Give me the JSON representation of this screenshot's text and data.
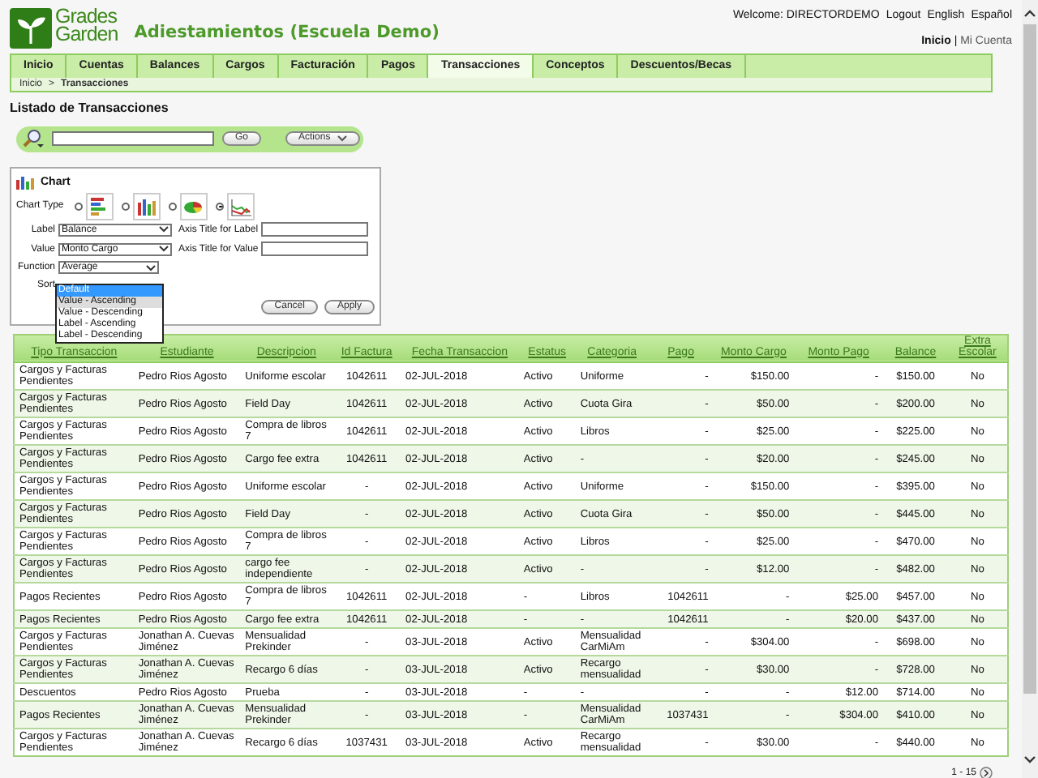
{
  "header": {
    "logo_line_1": "Grades",
    "logo_line_2": "Garden",
    "app_title": "Adiestamientos (Escuela Demo)",
    "user_links": [
      "Welcome: DIRECTORDEMO",
      "Logout",
      "English",
      "Español"
    ],
    "account_links": [
      {
        "label": "Inicio",
        "selected": true
      },
      {
        "label": "Mi Cuenta",
        "selected": false
      }
    ],
    "account_separator": "|"
  },
  "tabs": [
    {
      "label": "Inicio",
      "selected": false
    },
    {
      "label": "Cuentas",
      "selected": false
    },
    {
      "label": "Balances",
      "selected": false
    },
    {
      "label": "Cargos",
      "selected": false
    },
    {
      "label": "Facturación",
      "selected": false
    },
    {
      "label": "Pagos",
      "selected": false
    },
    {
      "label": "Transacciones",
      "selected": true
    },
    {
      "label": "Conceptos",
      "selected": false
    },
    {
      "label": "Descuentos/Becas",
      "selected": false
    }
  ],
  "breadcrumb": {
    "items": [
      "Inicio",
      "Transacciones"
    ],
    "separator": ">"
  },
  "page_title": "Listado de Transacciones",
  "search": {
    "go_button": "Go",
    "actions_button": "Actions"
  },
  "chart_panel": {
    "title": "Chart",
    "chart_type_label": "Chart Type",
    "chart_types": [
      {
        "kind": "bar",
        "selected": false
      },
      {
        "kind": "column",
        "selected": false
      },
      {
        "kind": "pie",
        "selected": false
      },
      {
        "kind": "line",
        "selected": true
      }
    ],
    "fields": [
      {
        "label": "Label",
        "value": "Balance",
        "axis_label": "Axis Title for Label"
      },
      {
        "label": "Value",
        "value": "Monto Cargo",
        "axis_label": "Axis Title for Value"
      }
    ],
    "function": {
      "label": "Function",
      "value": "Average"
    },
    "sort": {
      "label": "Sort",
      "options": [
        {
          "label": "Default",
          "selected": true,
          "hovered": false
        },
        {
          "label": "Value - Ascending",
          "selected": false,
          "hovered": true
        },
        {
          "label": "Value - Descending",
          "selected": false,
          "hovered": false
        },
        {
          "label": "Label - Ascending",
          "selected": false,
          "hovered": false
        },
        {
          "label": "Label - Descending",
          "selected": false,
          "hovered": false
        }
      ]
    },
    "buttons": [
      "Cancel",
      "Apply"
    ]
  },
  "table": {
    "columns": [
      "Tipo Transaccion",
      "Estudiante",
      "Descripcion",
      "Id Factura",
      "Fecha Transaccion",
      "Estatus",
      "Categoria",
      "Pago",
      "Monto Cargo",
      "Monto Pago",
      "Balance",
      "Extra Escolar"
    ],
    "rows": [
      [
        "Cargos y Facturas Pendientes",
        "Pedro Rios Agosto",
        "Uniforme escolar",
        "1042611",
        "02-JUL-2018",
        "Activo",
        "Uniforme",
        "-",
        "$150.00",
        "-",
        "$150.00",
        "No"
      ],
      [
        "Cargos y Facturas Pendientes",
        "Pedro Rios Agosto",
        "Field Day",
        "1042611",
        "02-JUL-2018",
        "Activo",
        "Cuota Gira",
        "-",
        "$50.00",
        "-",
        "$200.00",
        "No"
      ],
      [
        "Cargos y Facturas Pendientes",
        "Pedro Rios Agosto",
        "Compra de libros 7",
        "1042611",
        "02-JUL-2018",
        "Activo",
        "Libros",
        "-",
        "$25.00",
        "-",
        "$225.00",
        "No"
      ],
      [
        "Cargos y Facturas Pendientes",
        "Pedro Rios Agosto",
        "Cargo fee extra",
        "1042611",
        "02-JUL-2018",
        "Activo",
        "-",
        "-",
        "$20.00",
        "-",
        "$245.00",
        "No"
      ],
      [
        "Cargos y Facturas Pendientes",
        "Pedro Rios Agosto",
        "Uniforme escolar",
        "-",
        "02-JUL-2018",
        "Activo",
        "Uniforme",
        "-",
        "$150.00",
        "-",
        "$395.00",
        "No"
      ],
      [
        "Cargos y Facturas Pendientes",
        "Pedro Rios Agosto",
        "Field Day",
        "-",
        "02-JUL-2018",
        "Activo",
        "Cuota Gira",
        "-",
        "$50.00",
        "-",
        "$445.00",
        "No"
      ],
      [
        "Cargos y Facturas Pendientes",
        "Pedro Rios Agosto",
        "Compra de libros 7",
        "-",
        "02-JUL-2018",
        "Activo",
        "Libros",
        "-",
        "$25.00",
        "-",
        "$470.00",
        "No"
      ],
      [
        "Cargos y Facturas Pendientes",
        "Pedro Rios Agosto",
        "cargo fee independiente",
        "-",
        "02-JUL-2018",
        "Activo",
        "-",
        "-",
        "$12.00",
        "-",
        "$482.00",
        "No"
      ],
      [
        "Pagos Recientes",
        "Pedro Rios Agosto",
        "Compra de libros 7",
        "1042611",
        "02-JUL-2018",
        "-",
        "Libros",
        "1042611",
        "-",
        "$25.00",
        "$457.00",
        "No"
      ],
      [
        "Pagos Recientes",
        "Pedro Rios Agosto",
        "Cargo fee extra",
        "1042611",
        "02-JUL-2018",
        "-",
        "-",
        "1042611",
        "-",
        "$20.00",
        "$437.00",
        "No"
      ],
      [
        "Cargos y Facturas Pendientes",
        "Jonathan A. Cuevas Jiménez",
        "Mensualidad Prekinder",
        "-",
        "03-JUL-2018",
        "Activo",
        "Mensualidad CarMiAm",
        "-",
        "$304.00",
        "-",
        "$698.00",
        "No"
      ],
      [
        "Cargos y Facturas Pendientes",
        "Jonathan A. Cuevas Jiménez",
        "Recargo 6 días",
        "-",
        "03-JUL-2018",
        "Activo",
        "Recargo mensualidad",
        "-",
        "$30.00",
        "-",
        "$728.00",
        "No"
      ],
      [
        "Descuentos",
        "Pedro Rios Agosto",
        "Prueba",
        "-",
        "03-JUL-2018",
        "-",
        "-",
        "-",
        "-",
        "$12.00",
        "$714.00",
        "No"
      ],
      [
        "Pagos Recientes",
        "Jonathan A. Cuevas Jiménez",
        "Mensualidad Prekinder",
        "-",
        "03-JUL-2018",
        "-",
        "Mensualidad CarMiAm",
        "1037431",
        "-",
        "$304.00",
        "$410.00",
        "No"
      ],
      [
        "Cargos y Facturas Pendientes",
        "Jonathan A. Cuevas Jiménez",
        "Recargo 6 días",
        "1037431",
        "03-JUL-2018",
        "Activo",
        "Recargo mensualidad",
        "-",
        "$30.00",
        "-",
        "$440.00",
        "No"
      ]
    ]
  },
  "pagination": {
    "range": "1 - 15"
  }
}
